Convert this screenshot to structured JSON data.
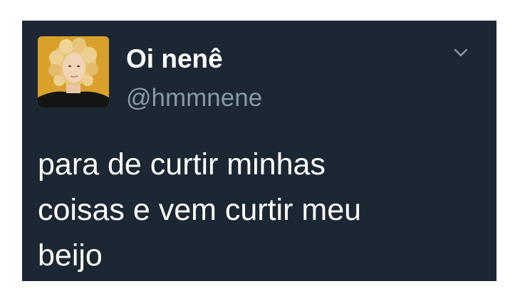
{
  "tweet": {
    "display_name": "Oi nenê",
    "handle": "@hmmnene",
    "text_lines": [
      "para de curtir minhas",
      "coisas e vem curtir meu",
      "beijo"
    ]
  },
  "icons": {
    "avatar": "profile-photo",
    "menu": "chevron-down-icon"
  },
  "colors": {
    "card_background": "#1c2733",
    "name_text": "#ffffff",
    "handle_text": "#8899a6",
    "body_text": "#ffffff",
    "avatar_background": "#d9a12c"
  }
}
